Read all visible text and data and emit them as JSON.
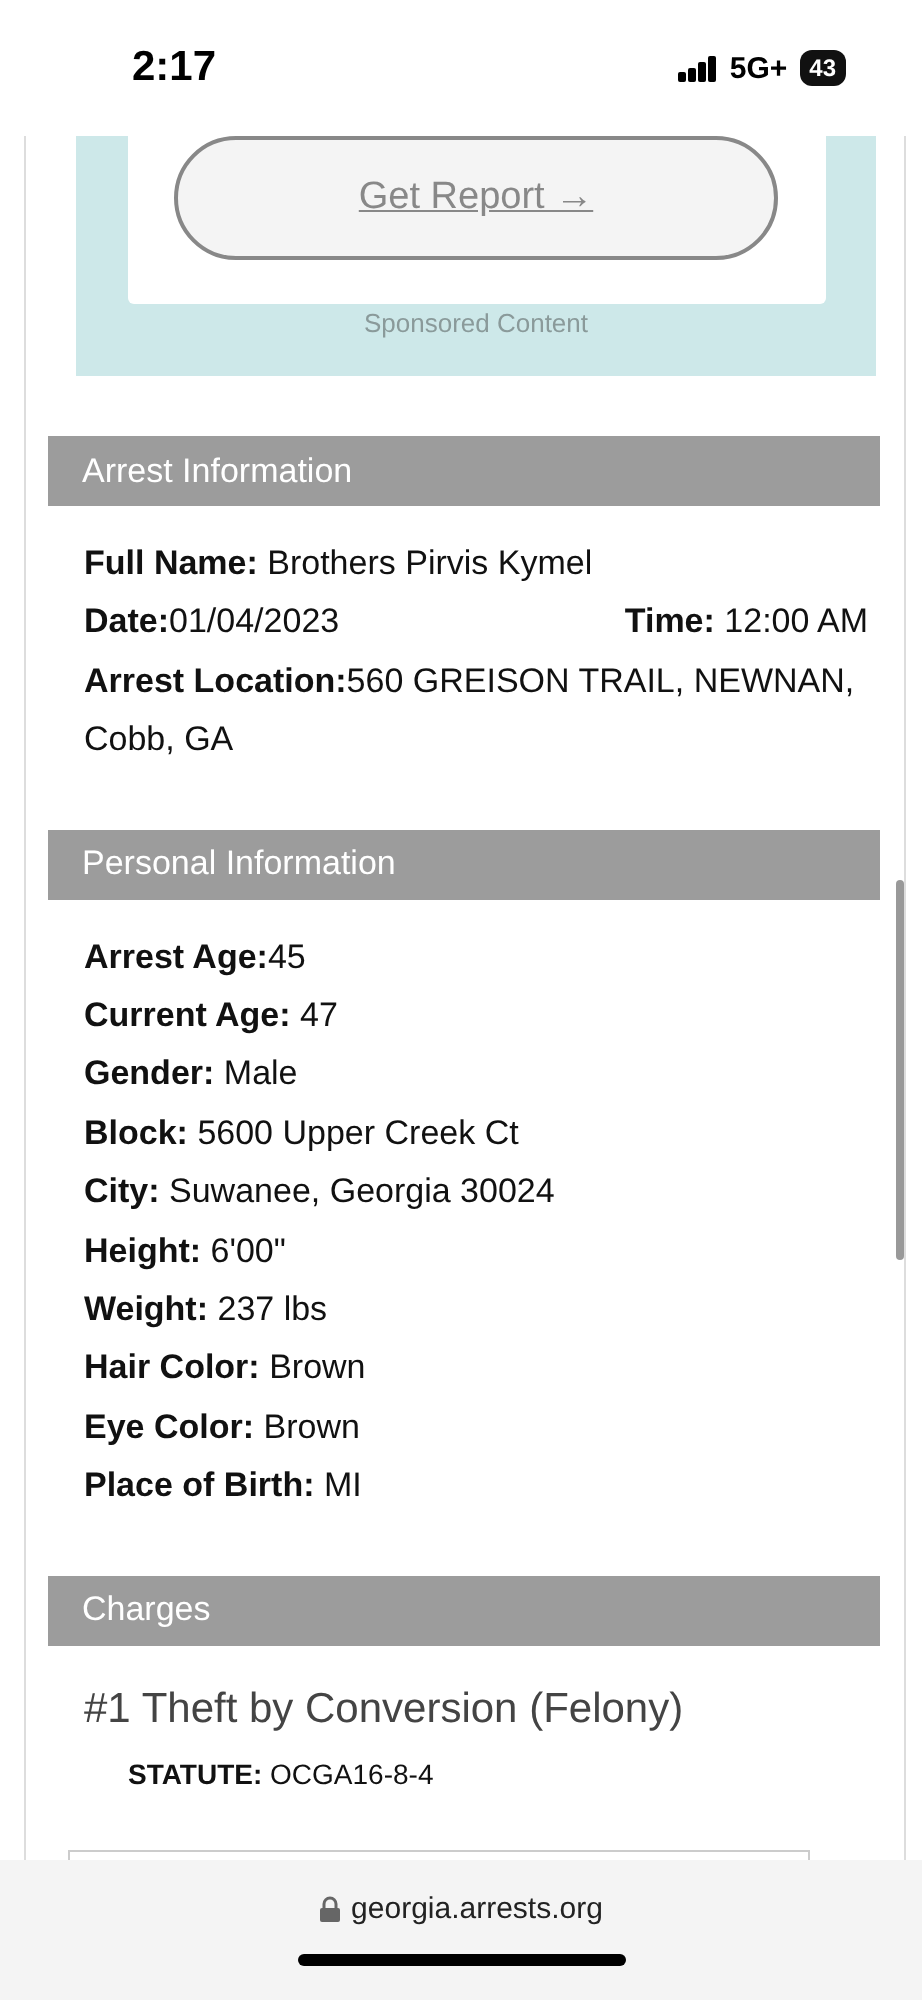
{
  "status_bar": {
    "time": "2:17",
    "network": "5G+",
    "battery": "43"
  },
  "sponsored": {
    "button": "Get Report →",
    "caption": "Sponsored Content"
  },
  "sections": [
    {
      "title": "Arrest Information",
      "rows": [
        {
          "kind": "line",
          "text": "**Full Name:** Brothers Pirvis Kymel"
        },
        {
          "kind": "pair",
          "text": "**Date:**01/04/2023",
          "text_right": "**Time:** 12:00 AM"
        },
        {
          "kind": "line",
          "text": "**Arrest Location:**560 GREISON TRAIL, NEWNAN, Cobb, GA"
        }
      ]
    },
    {
      "title": "Personal Information",
      "rows": [
        {
          "kind": "line",
          "text": "**Arrest Age:**45"
        },
        {
          "kind": "line",
          "text": "**Current Age:** 47"
        },
        {
          "kind": "line",
          "text": "**Gender:** Male"
        },
        {
          "kind": "line",
          "text": "**Block:** 5600 Upper Creek Ct"
        },
        {
          "kind": "line",
          "text": "**City:** Suwanee, Georgia 30024"
        },
        {
          "kind": "line",
          "text": "**Height:** 6'00\""
        },
        {
          "kind": "line",
          "text": "**Weight:** 237 lbs"
        },
        {
          "kind": "line",
          "text": "**Hair Color:** Brown"
        },
        {
          "kind": "line",
          "text": "**Eye Color:** Brown"
        },
        {
          "kind": "line",
          "text": "**Place of Birth:** MI"
        }
      ]
    },
    {
      "title": "Charges",
      "rows": [
        {
          "kind": "charge",
          "text": "#1 Theft by Conversion (Felony)"
        },
        {
          "kind": "statute",
          "text": "**STATUTE:** OCGA16-8-4"
        }
      ]
    }
  ],
  "address_bar": {
    "url": "georgia.arrests.org"
  }
}
